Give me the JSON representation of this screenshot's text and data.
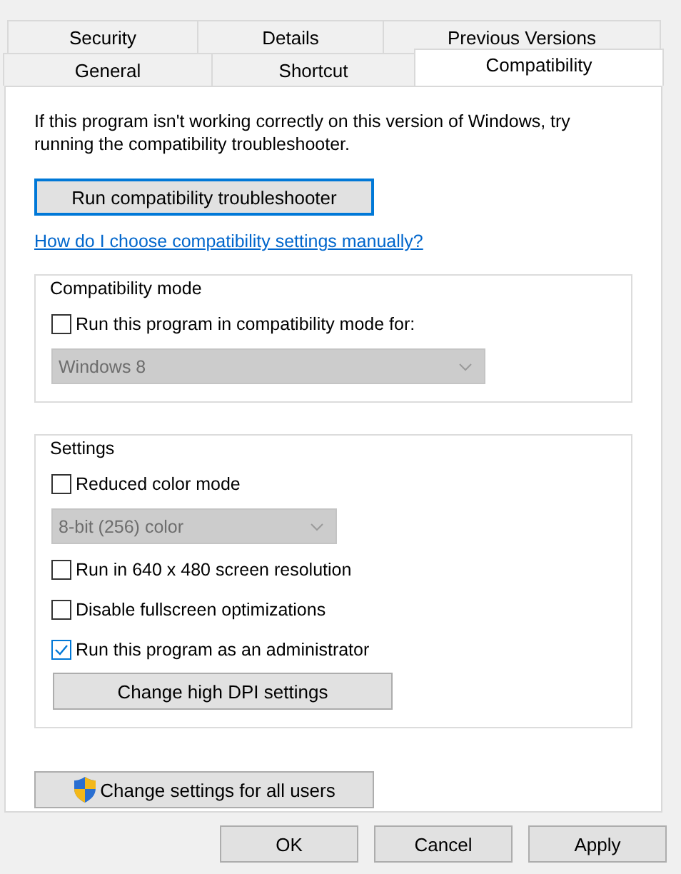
{
  "tab_rows": [
    [
      {
        "label": "Security",
        "selected": false
      },
      {
        "label": "Details",
        "selected": false
      },
      {
        "label": "Previous Versions",
        "selected": false
      }
    ],
    [
      {
        "label": "General",
        "selected": false
      },
      {
        "label": "Shortcut",
        "selected": false
      },
      {
        "label": "Compatibility",
        "selected": true
      }
    ]
  ],
  "intro": "If this program isn't working correctly on this version of Windows, try running the compatibility troubleshooter.",
  "troubleshooter_button": {
    "label": "Run compatibility troubleshooter",
    "focused": true
  },
  "help_link": "How do I choose compatibility settings manually?",
  "groups": [
    {
      "title": "Compatibility mode",
      "items": [
        {
          "kind": "checkbox",
          "label": "Run this program in compatibility mode for:",
          "checked": false
        },
        {
          "kind": "dropdown",
          "value": "Windows 8",
          "disabled": true
        }
      ]
    },
    {
      "title": "Settings",
      "items": [
        {
          "kind": "checkbox",
          "label": "Reduced color mode",
          "checked": false
        },
        {
          "kind": "dropdown",
          "value": "8-bit (256) color",
          "disabled": true
        },
        {
          "kind": "checkbox",
          "label": "Run in 640 x 480 screen resolution",
          "checked": false
        },
        {
          "kind": "checkbox",
          "label": "Disable fullscreen optimizations",
          "checked": false
        },
        {
          "kind": "checkbox",
          "label": "Run this program as an administrator",
          "checked": true
        },
        {
          "kind": "button",
          "label": "Change high DPI settings"
        }
      ]
    }
  ],
  "all_users_button": {
    "label": "Change settings for all users"
  },
  "dialog_buttons": [
    "OK",
    "Cancel",
    "Apply"
  ]
}
